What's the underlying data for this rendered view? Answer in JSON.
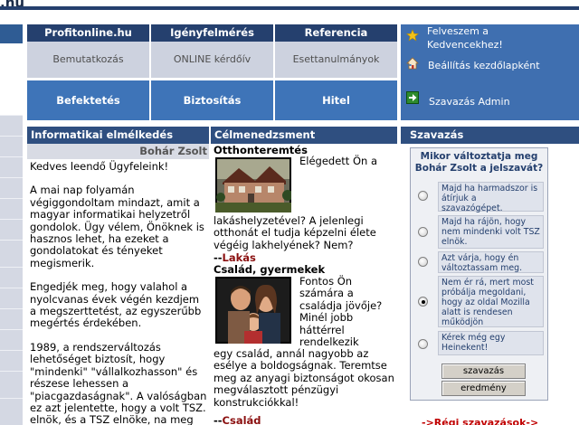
{
  "site_suffix": ".hu",
  "nav": {
    "top_tabs": [
      "Profitonline.hu",
      "Igényfelmérés",
      "Referencia"
    ],
    "sub_tabs": [
      "Bemutatkozás",
      "ONLINE kérdőív",
      "Esettanulmányok"
    ],
    "big_tabs": [
      "Befektetés",
      "Biztosítás",
      "Hitel"
    ]
  },
  "right_panel": {
    "favorite_line1": "Felveszem a",
    "favorite_line2": "Kedvencekhez!",
    "homepage": "Beállítás kezdőlapként",
    "vote_admin": "Szavazás Admin"
  },
  "info": {
    "title": "Informatikai elmélkedés",
    "author": "Bohár Zsolt",
    "paragraphs": [
      "Kedves leendő Ügyfeleink!",
      "A mai nap folyamán végiggondoltam mindazt, amit a magyar informatikai helyzetről gondolok. Ügy vélem, Önöknek is hasznos lehet, ha ezeket a gondolatokat és tényeket megismerik.",
      "Engedjék meg, hogy valahol a nyolcvanas évek végén kezdjem a megszerttetést, az egyszerűbb megértés érdekében.",
      "1989, a rendszerváltozás lehetőséget biztosít, hogy \"mindenki\" \"vállalkozhasson\" és részese lehessen a \"piacgazdaságnak\". A valóságban ez azt jelentette, hogy a volt TSZ. elnök, és a TSZ elnöke, na meg"
    ]
  },
  "celmenedzsment": {
    "title": "Célmenedzsment",
    "item1": {
      "title": "Otthonteremtés",
      "text_side": "Elégedett Ön a",
      "text_below": "lakáshelyzetével? A jelenlegi otthonát el tudja képzelni élete végéig lakhelyének? Nem?",
      "link": "Lakás"
    },
    "item2": {
      "title": "Család, gyermekek",
      "text_side": "Fontos Ön számára a családja jövője? Minél jobb háttérrel rendelkezik",
      "text_below": "egy család, annál nagyobb az esélye a boldogságnak. Teremtse meg az anyagi biztonságot okosan megválasztott pénzügyi konstrukciókkal!",
      "link": "Család"
    },
    "link_prefix": "--"
  },
  "vote": {
    "title": "Szavazás",
    "question": "Mikor változtatja meg Bohár Zsolt a jelszavát?",
    "options": [
      "Majd ha harmadszor is átírjuk a szavazógépet.",
      "Majd ha rájön, hogy nem mindenki volt TSZ elnök.",
      "Azt várja, hogy én változtassam meg.",
      "Nem ér rá, mert most próbálja megoldani, hogy az oldal Mozilla alatt is rendesen működjön",
      "Kérek még egy Heinekent!"
    ],
    "selected_index": 3,
    "vote_button": "szavazás",
    "results_button": "eredmény",
    "old_polls": "->Régi szavazások->"
  }
}
